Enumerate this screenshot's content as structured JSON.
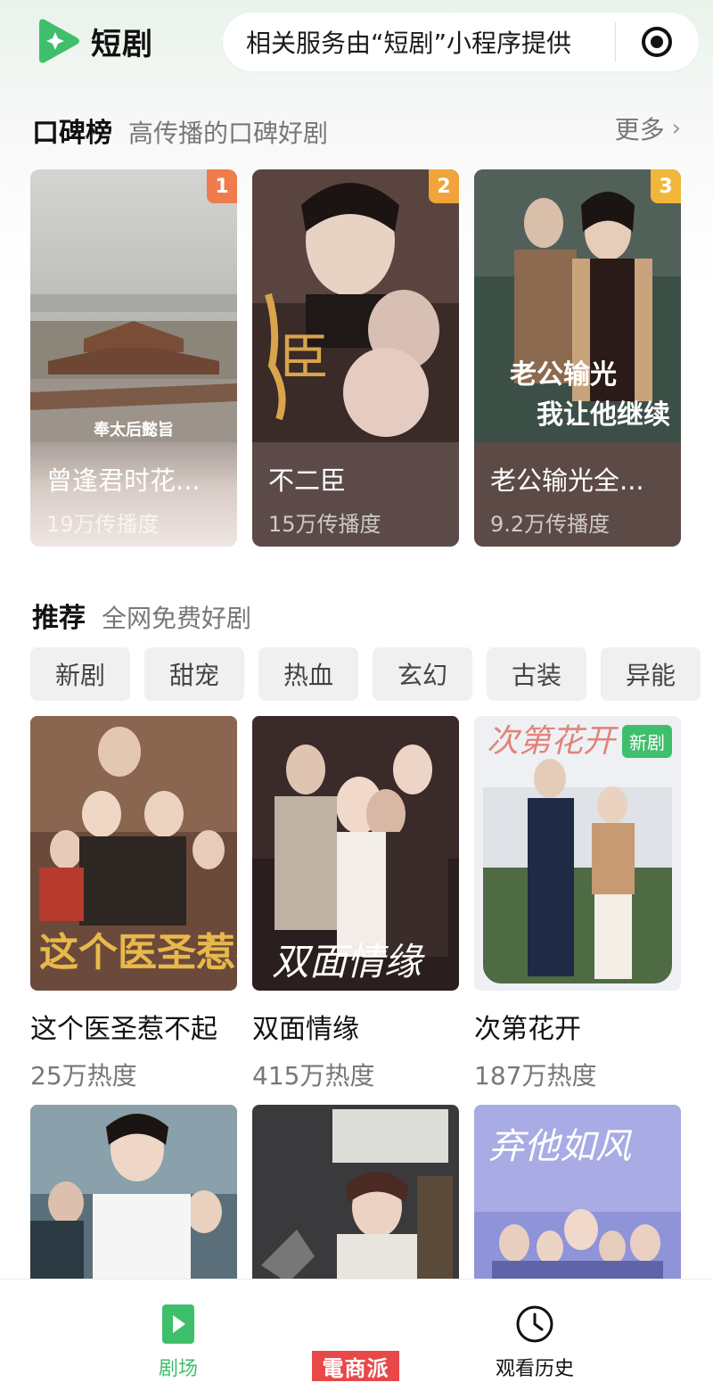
{
  "app": {
    "title": "短剧",
    "notice": "相关服务由“短剧”小程序提供",
    "brand_color": "#3fbf6b"
  },
  "ranking": {
    "title": "口碑榜",
    "subtitle": "高传播的口碑好剧",
    "more_label": "更多",
    "items": [
      {
        "rank": "1",
        "title": "曾逢君时花...",
        "stat": "19万传播度",
        "caption": "奉太后懿旨",
        "badge_color": "#f07b4d",
        "info_bg": "#efe3df"
      },
      {
        "rank": "2",
        "title": "不二臣",
        "stat": "15万传播度",
        "caption": "",
        "badge_color": "#f0a43a",
        "info_bg": "#5a4a46"
      },
      {
        "rank": "3",
        "title": "老公输光全...",
        "stat": "9.2万传播度",
        "caption": "",
        "badge_color": "#f2b73a",
        "info_bg": "#5a4846"
      }
    ]
  },
  "recommend": {
    "title": "推荐",
    "subtitle": "全网免费好剧",
    "tags": [
      "新剧",
      "甜宠",
      "热血",
      "玄幻",
      "古装",
      "异能"
    ],
    "items": [
      {
        "title": "这个医圣惹不起",
        "heat": "25万热度",
        "poster_text": "这个医圣惹不起",
        "badge": ""
      },
      {
        "title": "双面情缘",
        "heat": "415万热度",
        "poster_text": "双面情缘",
        "badge": ""
      },
      {
        "title": "次第花开",
        "heat": "187万热度",
        "poster_text": "次第花开",
        "badge": "新剧"
      },
      {
        "title": "",
        "heat": "",
        "poster_text": "",
        "badge": ""
      },
      {
        "title": "",
        "heat": "",
        "poster_text": "",
        "badge": ""
      },
      {
        "title": "",
        "heat": "",
        "poster_text": "弃他如风",
        "badge": ""
      }
    ]
  },
  "bottom_nav": {
    "items": [
      {
        "label": "剧场",
        "icon": "play-icon",
        "active": true
      },
      {
        "label": "观看历史",
        "icon": "clock-icon",
        "active": false
      }
    ],
    "watermark": "電商派"
  }
}
